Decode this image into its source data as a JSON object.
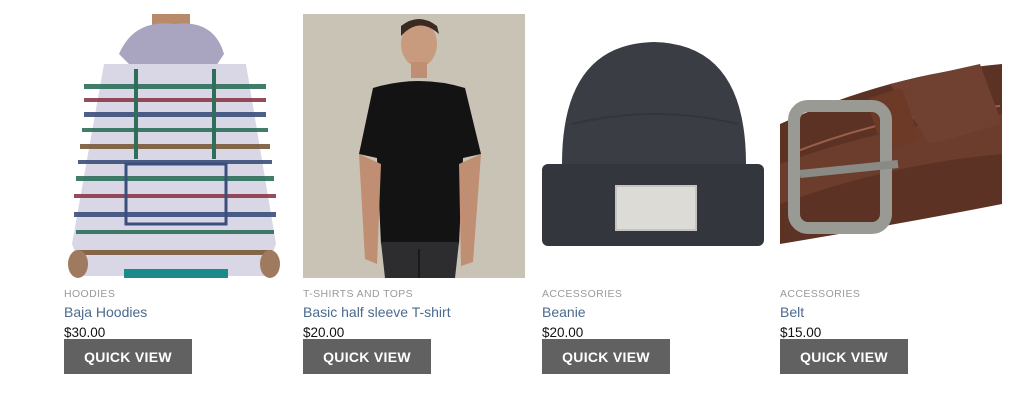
{
  "products": [
    {
      "category": "HOODIES",
      "name": "Baja Hoodies",
      "price": "$30.00",
      "button": "QUICK VIEW"
    },
    {
      "category": "T-SHIRTS AND TOPS",
      "name": "Basic half sleeve T-shirt",
      "price": "$20.00",
      "button": "QUICK VIEW"
    },
    {
      "category": "ACCESSORIES",
      "name": "Beanie",
      "price": "$20.00",
      "button": "QUICK VIEW"
    },
    {
      "category": "ACCESSORIES",
      "name": "Belt",
      "price": "$15.00",
      "button": "QUICK VIEW"
    }
  ],
  "colors": {
    "category_text": "#9a9a9a",
    "product_link": "#4a6a8e",
    "button_bg": "#616161",
    "button_text": "#ffffff"
  }
}
